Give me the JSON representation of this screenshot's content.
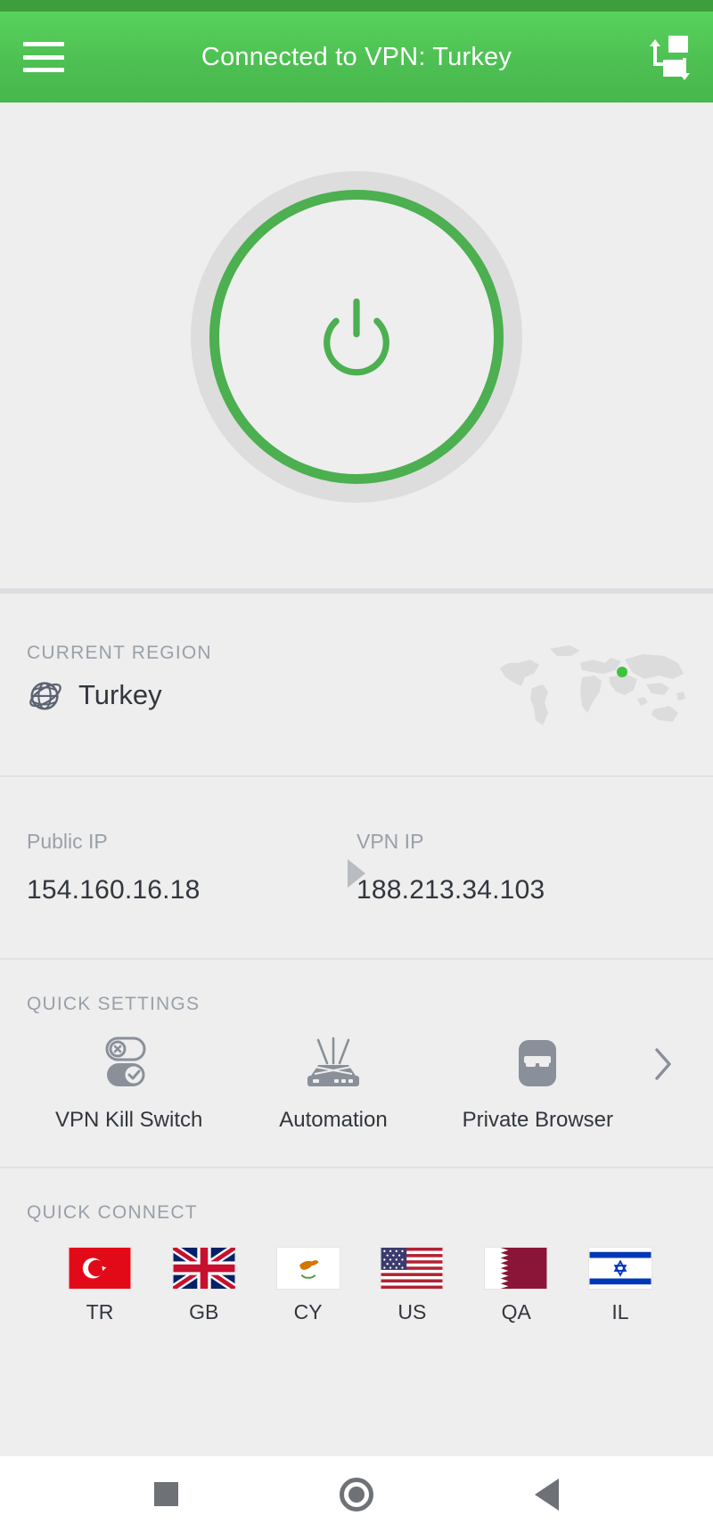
{
  "app": {
    "accent_color": "#4caf50",
    "appbar_color": "#4ec053",
    "statusbar_color": "#3e9e3e",
    "background_color": "#eeeeee",
    "text_color": "#32363d",
    "muted_text_color": "#9aa0a9"
  },
  "appbar": {
    "title": "Connected to VPN: Turkey",
    "menu_icon": "hamburger-menu-icon",
    "transfer_icon": "data-transfer-icon"
  },
  "hero": {
    "power_button_icon": "power-icon",
    "power_state": "on",
    "ring_color": "#4caf50"
  },
  "region": {
    "label": "CURRENT REGION",
    "icon": "globe-icon",
    "name": "Turkey",
    "map_icon": "world-map",
    "marker_color": "#3fc23f"
  },
  "ips": {
    "public": {
      "label": "Public IP",
      "value": "154.160.16.18"
    },
    "vpn": {
      "label": "VPN IP",
      "value": "188.213.34.103"
    },
    "arrow_icon": "right-triangle-icon"
  },
  "quick_settings": {
    "label": "QUICK SETTINGS",
    "chevron_icon": "chevron-right-icon",
    "items": [
      {
        "label": "VPN Kill Switch",
        "icon": "kill-switch-icon"
      },
      {
        "label": "Automation",
        "icon": "router-icon"
      },
      {
        "label": "Private Browser",
        "icon": "incognito-mask-icon"
      }
    ]
  },
  "quick_connect": {
    "label": "QUICK CONNECT",
    "items": [
      {
        "code": "TR",
        "icon": "flag-tr"
      },
      {
        "code": "GB",
        "icon": "flag-gb"
      },
      {
        "code": "CY",
        "icon": "flag-cy"
      },
      {
        "code": "US",
        "icon": "flag-us"
      },
      {
        "code": "QA",
        "icon": "flag-qa"
      },
      {
        "code": "IL",
        "icon": "flag-il"
      }
    ]
  },
  "navbar": {
    "recent_icon": "square-recents-icon",
    "home_icon": "circle-home-icon",
    "back_icon": "triangle-back-icon"
  }
}
